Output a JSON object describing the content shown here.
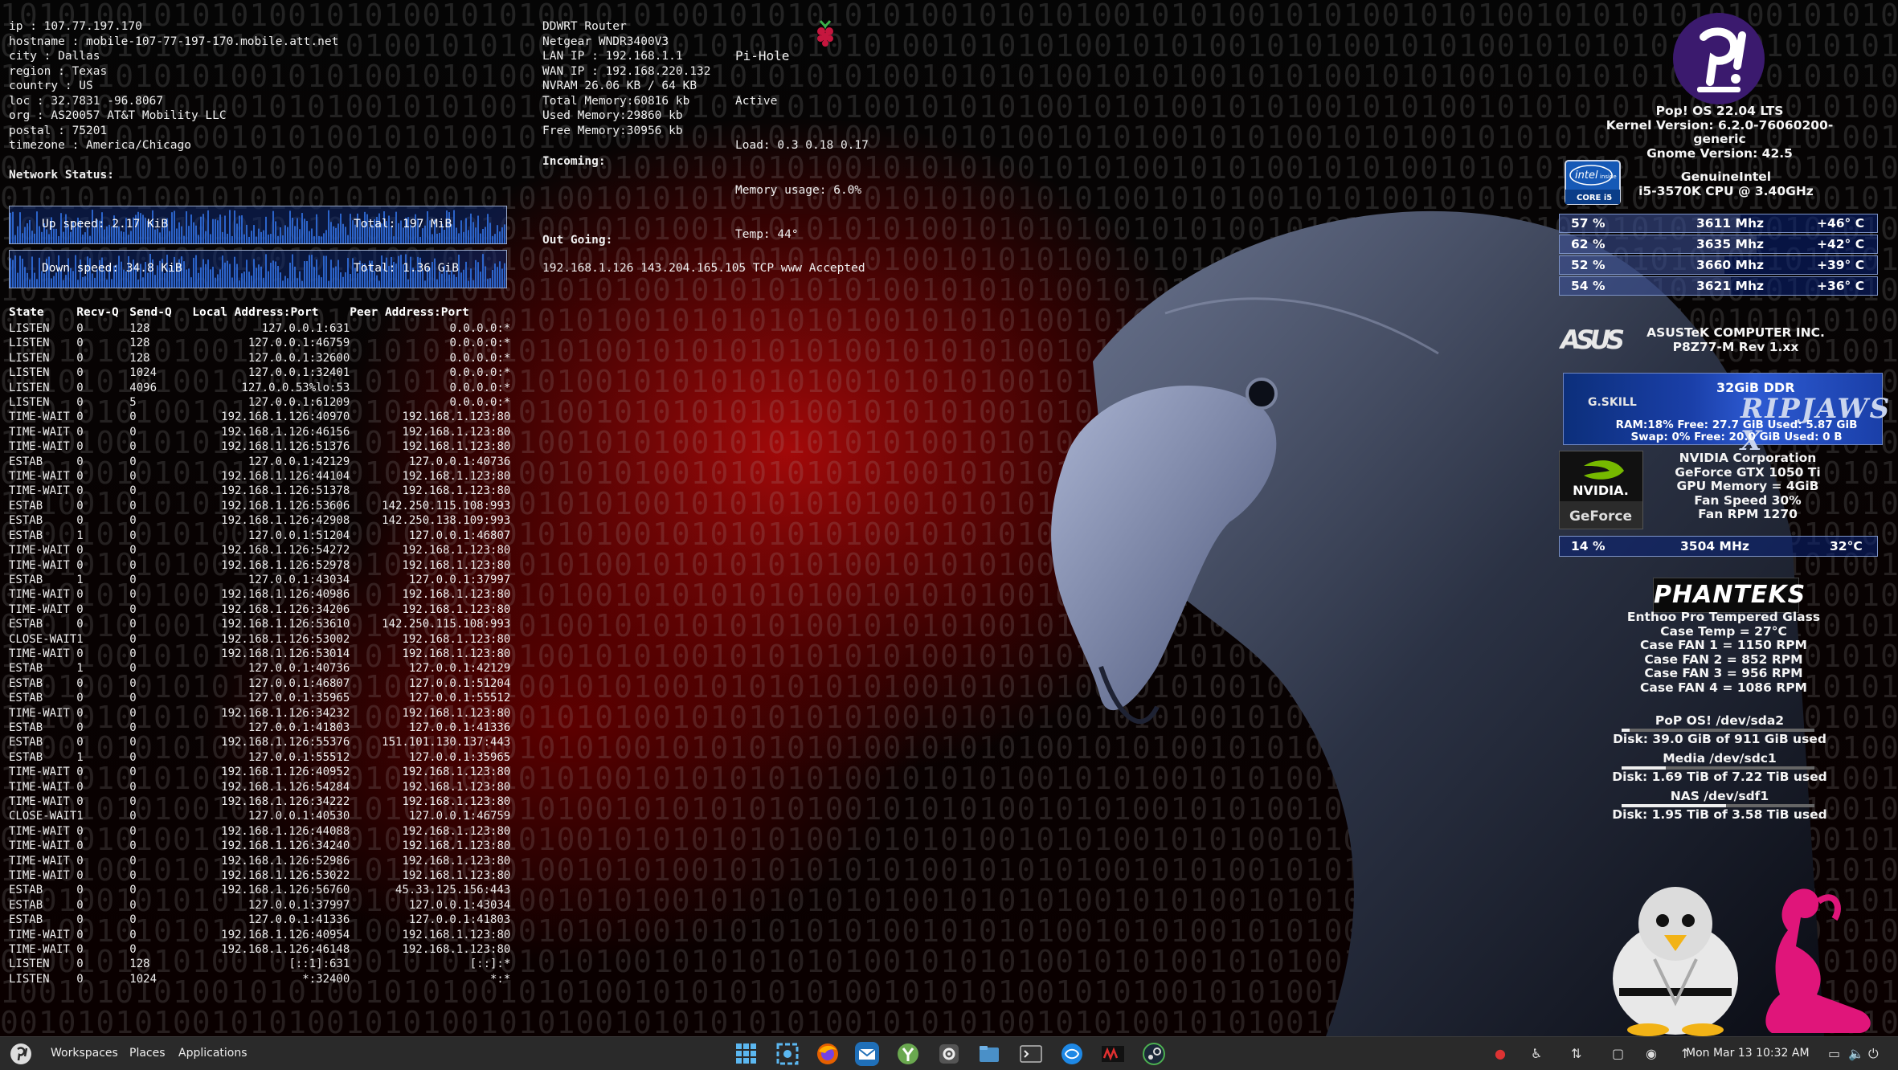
{
  "ipinfo": [
    "ip : 107.77.197.170",
    "hostname : mobile-107-77-197-170.mobile.att.net",
    "city : Dallas",
    "region : Texas",
    "country : US",
    "loc : 32.7831 -96.8067",
    "org : AS20057 AT&T Mobility LLC",
    "postal : 75201",
    "timezone : America/Chicago"
  ],
  "network": {
    "status_label": "Network Status:",
    "up_label": "Up speed: 2.17 KiB",
    "up_total": "Total: 197 MiB",
    "down_label": "Down speed: 34.8 KiB",
    "down_total": "Total: 1.36 GiB"
  },
  "router": {
    "lines": [
      "DDWRT Router",
      "Netgear WNDR3400V3",
      "LAN IP : 192.168.1.1",
      "WAN IP : 192.168.220.132",
      "NVRAM 26.06 KB / 64 KB",
      "Total Memory:60816 kb",
      "Used Memory:29860 kb",
      "Free Memory:30956 kb"
    ],
    "incoming_label": "Incoming:",
    "outgoing_label": "Out Going:",
    "outgoing_line": "192.168.1.126 143.204.165.105 TCP www Accepted"
  },
  "pihole": {
    "title": "Pi-Hole",
    "status": "Active",
    "load": "Load: 0.3 0.18 0.17",
    "memory": "Memory usage: 6.0%",
    "temp": "Temp: 44°"
  },
  "netstat": {
    "headers": [
      "State",
      "Recv-Q",
      "Send-Q",
      "Local Address:Port",
      "Peer Address:Port"
    ],
    "rows": [
      [
        "LISTEN",
        "0",
        "128",
        "127.0.0.1:631",
        "0.0.0.0:*"
      ],
      [
        "LISTEN",
        "0",
        "128",
        "127.0.0.1:46759",
        "0.0.0.0:*"
      ],
      [
        "LISTEN",
        "0",
        "128",
        "127.0.0.1:32600",
        "0.0.0.0:*"
      ],
      [
        "LISTEN",
        "0",
        "1024",
        "127.0.0.1:32401",
        "0.0.0.0:*"
      ],
      [
        "LISTEN",
        "0",
        "4096",
        "127.0.0.53%lo:53",
        "0.0.0.0:*"
      ],
      [
        "LISTEN",
        "0",
        "5",
        "127.0.0.1:61209",
        "0.0.0.0:*"
      ],
      [
        "TIME-WAIT",
        "0",
        "0",
        "192.168.1.126:40970",
        "192.168.1.123:80"
      ],
      [
        "TIME-WAIT",
        "0",
        "0",
        "192.168.1.126:46156",
        "192.168.1.123:80"
      ],
      [
        "TIME-WAIT",
        "0",
        "0",
        "192.168.1.126:51376",
        "192.168.1.123:80"
      ],
      [
        "ESTAB",
        "0",
        "0",
        "127.0.0.1:42129",
        "127.0.0.1:40736"
      ],
      [
        "TIME-WAIT",
        "0",
        "0",
        "192.168.1.126:44104",
        "192.168.1.123:80"
      ],
      [
        "TIME-WAIT",
        "0",
        "0",
        "192.168.1.126:51378",
        "192.168.1.123:80"
      ],
      [
        "ESTAB",
        "0",
        "0",
        "192.168.1.126:53606",
        "142.250.115.108:993"
      ],
      [
        "ESTAB",
        "0",
        "0",
        "192.168.1.126:42908",
        "142.250.138.109:993"
      ],
      [
        "ESTAB",
        "1",
        "0",
        "127.0.0.1:51204",
        "127.0.0.1:46807"
      ],
      [
        "TIME-WAIT",
        "0",
        "0",
        "192.168.1.126:54272",
        "192.168.1.123:80"
      ],
      [
        "TIME-WAIT",
        "0",
        "0",
        "192.168.1.126:52978",
        "192.168.1.123:80"
      ],
      [
        "ESTAB",
        "1",
        "0",
        "127.0.0.1:43034",
        "127.0.0.1:37997"
      ],
      [
        "TIME-WAIT",
        "0",
        "0",
        "192.168.1.126:40986",
        "192.168.1.123:80"
      ],
      [
        "TIME-WAIT",
        "0",
        "0",
        "192.168.1.126:34206",
        "192.168.1.123:80"
      ],
      [
        "ESTAB",
        "0",
        "0",
        "192.168.1.126:53610",
        "142.250.115.108:993"
      ],
      [
        "CLOSE-WAIT",
        "1",
        "0",
        "192.168.1.126:53002",
        "192.168.1.123:80"
      ],
      [
        "TIME-WAIT",
        "0",
        "0",
        "192.168.1.126:53014",
        "192.168.1.123:80"
      ],
      [
        "ESTAB",
        "1",
        "0",
        "127.0.0.1:40736",
        "127.0.0.1:42129"
      ],
      [
        "ESTAB",
        "0",
        "0",
        "127.0.0.1:46807",
        "127.0.0.1:51204"
      ],
      [
        "ESTAB",
        "0",
        "0",
        "127.0.0.1:35965",
        "127.0.0.1:55512"
      ],
      [
        "TIME-WAIT",
        "0",
        "0",
        "192.168.1.126:34232",
        "192.168.1.123:80"
      ],
      [
        "ESTAB",
        "0",
        "0",
        "127.0.0.1:41803",
        "127.0.0.1:41336"
      ],
      [
        "ESTAB",
        "0",
        "0",
        "192.168.1.126:55376",
        "151.101.130.137:443"
      ],
      [
        "ESTAB",
        "1",
        "0",
        "127.0.0.1:55512",
        "127.0.0.1:35965"
      ],
      [
        "TIME-WAIT",
        "0",
        "0",
        "192.168.1.126:40952",
        "192.168.1.123:80"
      ],
      [
        "TIME-WAIT",
        "0",
        "0",
        "192.168.1.126:54284",
        "192.168.1.123:80"
      ],
      [
        "TIME-WAIT",
        "0",
        "0",
        "192.168.1.126:34222",
        "192.168.1.123:80"
      ],
      [
        "CLOSE-WAIT",
        "1",
        "0",
        "127.0.0.1:40530",
        "127.0.0.1:46759"
      ],
      [
        "TIME-WAIT",
        "0",
        "0",
        "192.168.1.126:44088",
        "192.168.1.123:80"
      ],
      [
        "TIME-WAIT",
        "0",
        "0",
        "192.168.1.126:34240",
        "192.168.1.123:80"
      ],
      [
        "TIME-WAIT",
        "0",
        "0",
        "192.168.1.126:52986",
        "192.168.1.123:80"
      ],
      [
        "TIME-WAIT",
        "0",
        "0",
        "192.168.1.126:53022",
        "192.168.1.123:80"
      ],
      [
        "ESTAB",
        "0",
        "0",
        "192.168.1.126:56760",
        "45.33.125.156:443"
      ],
      [
        "ESTAB",
        "0",
        "0",
        "127.0.0.1:37997",
        "127.0.0.1:43034"
      ],
      [
        "ESTAB",
        "0",
        "0",
        "127.0.0.1:41336",
        "127.0.0.1:41803"
      ],
      [
        "TIME-WAIT",
        "0",
        "0",
        "192.168.1.126:40954",
        "192.168.1.123:80"
      ],
      [
        "TIME-WAIT",
        "0",
        "0",
        "192.168.1.126:46148",
        "192.168.1.123:80"
      ],
      [
        "LISTEN",
        "0",
        "128",
        "[::1]:631",
        "[::]:*"
      ],
      [
        "LISTEN",
        "0",
        "1024",
        "*:32400",
        "*:*"
      ]
    ]
  },
  "system": {
    "os": "Pop! OS 22.04 LTS",
    "kernel": "Kernel Version: 6.2.0-76060200-generic",
    "gnome": "Gnome Version: 42.5",
    "cpu_vendor": "GenuineIntel",
    "cpu_model": "i5-3570K CPU @ 3.40GHz",
    "intel_badge_top": "intel",
    "intel_badge_inside": "inside",
    "intel_badge_bottom": "CORE i5",
    "cores": [
      {
        "usage": "57 %",
        "usage_fraction": 0.57,
        "freq": "3611 Mhz",
        "temp": "+46° C"
      },
      {
        "usage": "62 %",
        "usage_fraction": 0.62,
        "freq": "3635 Mhz",
        "temp": "+42° C"
      },
      {
        "usage": "52 %",
        "usage_fraction": 0.52,
        "freq": "3660 Mhz",
        "temp": "+39° C"
      },
      {
        "usage": "54 %",
        "usage_fraction": 0.54,
        "freq": "3621 Mhz",
        "temp": "+36° C"
      }
    ],
    "board_vendor": "ASUSTeK COMPUTER INC.",
    "board_model": "P8Z77-M Rev 1.xx",
    "asus_logo": "ASUS",
    "ram_title": "32GiB DDR",
    "ram_brand": "RIPJAWS X",
    "ram_maker": "G.SKILL",
    "ram_line": "RAM:18% Free: 27.7 GiB Used: 5.87 GiB",
    "swap_line": "Swap: 0% Free: 20.0 GiB Used: 0 B",
    "nvidia_top": "NVIDIA.",
    "nvidia_bottom": "GeForce",
    "gpu_lines": [
      "NVIDIA Corporation",
      "GeForce GTX 1050 Ti",
      "GPU Memory = 4GiB",
      "Fan Speed 30%",
      "Fan RPM 1270"
    ],
    "gpu_usage": "14 %",
    "gpu_freq": "3504 MHz",
    "gpu_temp": "32°C",
    "case_brand": "PHANTEKS",
    "case_lines": [
      "Enthoo Pro Tempered Glass",
      "Case Temp = 27°C",
      "Case FAN 1 = 1150 RPM",
      "Case FAN 2 = 852 RPM",
      "Case FAN 3 = 956 RPM",
      "Case FAN 4 = 1086 RPM"
    ],
    "disks": [
      {
        "title": "PoP OS! /dev/sda2",
        "line": "Disk: 39.0 GiB of 911 GiB used",
        "fraction": 0.04
      },
      {
        "title": "Media /dev/sdc1",
        "line": "Disk: 1.69 TiB of 7.22 TiB used",
        "fraction": 0.23
      },
      {
        "title": "NAS /dev/sdf1",
        "line": "Disk: 1.95 TiB of 3.58 TiB used",
        "fraction": 0.54
      }
    ]
  },
  "taskbar": {
    "workspaces": "Workspaces",
    "places": "Places",
    "applications": "Applications",
    "clock": "Mon Mar 13  10:32 AM"
  },
  "colors": {
    "wallpaper_red": "#b40a0a",
    "panel_blue": "#0a2378",
    "popos_purple": "#3b1a6e",
    "pink": "#e0157a"
  }
}
